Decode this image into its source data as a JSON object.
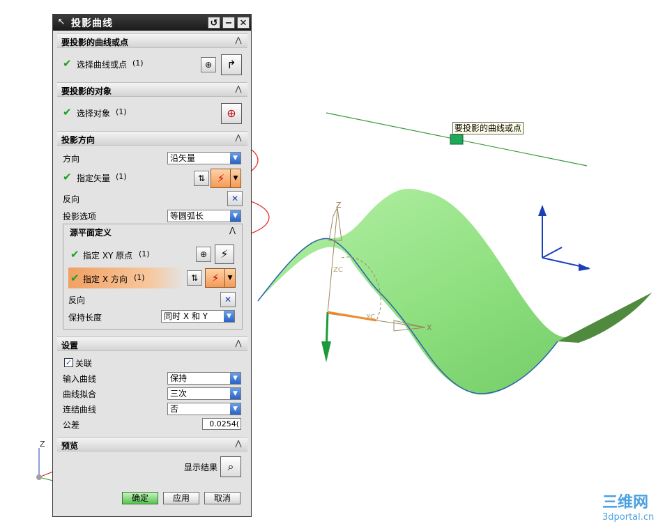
{
  "dialog": {
    "title": "投影曲线",
    "section_curves": {
      "title": "要投影的曲线或点",
      "select_label": "选择曲线或点",
      "select_count": "(1)"
    },
    "section_objects": {
      "title": "要投影的对象",
      "select_label": "选择对象",
      "select_count": "(1)"
    },
    "section_direction": {
      "title": "投影方向",
      "direction_label": "方向",
      "direction_value": "沿矢量",
      "vector_label": "指定矢量",
      "vector_count": "(1)",
      "reverse_label": "反向",
      "option_label": "投影选项",
      "option_value": "等圆弧长",
      "plane_def": {
        "title": "源平面定义",
        "xy_origin_label": "指定 XY 原点",
        "xy_origin_count": "(1)",
        "x_dir_label": "指定 X 方向",
        "x_dir_count": "(1)",
        "reverse_label": "反向",
        "keep_length_label": "保持长度",
        "keep_length_value": "同时 X 和 Y"
      }
    },
    "section_settings": {
      "title": "设置",
      "associative_label": "关联",
      "associative_checked": true,
      "input_curve_label": "输入曲线",
      "input_curve_value": "保持",
      "curve_fit_label": "曲线拟合",
      "curve_fit_value": "三次",
      "join_curve_label": "连结曲线",
      "join_curve_value": "否",
      "tolerance_label": "公差",
      "tolerance_value": "0.0254("
    },
    "section_preview": {
      "title": "预览",
      "show_result_label": "显示结果"
    },
    "buttons": {
      "ok": "确定",
      "apply": "应用",
      "cancel": "取消"
    }
  },
  "viewport": {
    "tooltip": "要投影的曲线或点",
    "axis_z": "Z",
    "axis_x": "X",
    "axis_zc": "ZC",
    "axis_xc": "XC",
    "corner_axis_z": "Z",
    "logo_text": "三维网",
    "logo_url": "3dportal.cn",
    "surface_color": "#8fe080",
    "curve_color": "#3a9a3a"
  }
}
